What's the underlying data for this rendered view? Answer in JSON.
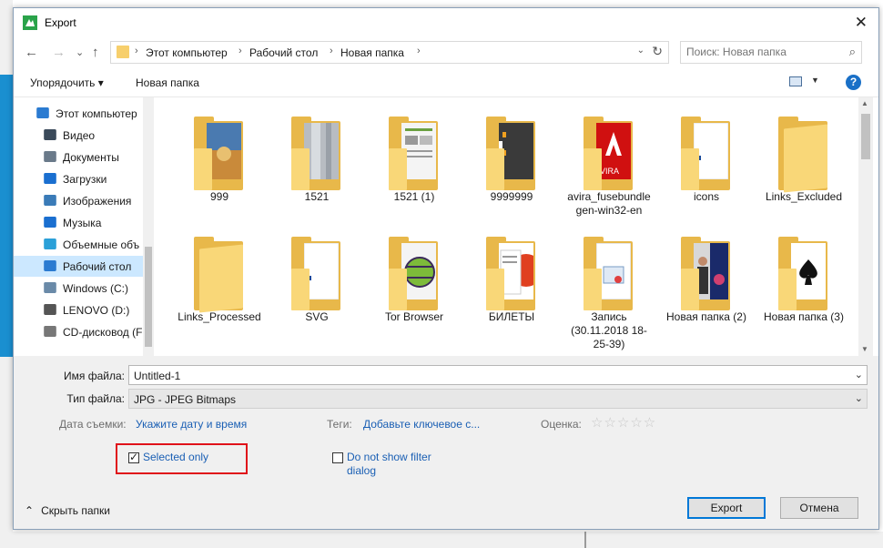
{
  "window": {
    "title": "Export",
    "close_glyph": "✕"
  },
  "nav": {
    "back_icon": "←",
    "forward_icon": "→",
    "recent_icon": "⌄",
    "up_icon": "↑",
    "breadcrumb": [
      "Этот компьютер",
      "Рабочий стол",
      "Новая папка"
    ],
    "separator": "›",
    "dropdown_icon": "⌄",
    "refresh_icon": "↻"
  },
  "search": {
    "placeholder": "Поиск: Новая папка",
    "icon": "⌕"
  },
  "toolbar": {
    "organize": "Упорядочить ▾",
    "new_folder": "Новая папка",
    "view_dd": "▼",
    "help": "?"
  },
  "sidebar": {
    "items": [
      {
        "label": "Этот компьютер",
        "icon": "computer-icon",
        "color": "#2b7bd1"
      },
      {
        "label": "Видео",
        "icon": "video-icon",
        "color": "#3a4a5a"
      },
      {
        "label": "Документы",
        "icon": "documents-icon",
        "color": "#6a7a8a"
      },
      {
        "label": "Загрузки",
        "icon": "downloads-icon",
        "color": "#1a6fd0"
      },
      {
        "label": "Изображения",
        "icon": "pictures-icon",
        "color": "#3a7bb8"
      },
      {
        "label": "Музыка",
        "icon": "music-icon",
        "color": "#1a6fd0"
      },
      {
        "label": "Объемные объ",
        "icon": "3d-objects-icon",
        "color": "#2ba0d8"
      },
      {
        "label": "Рабочий стол",
        "icon": "desktop-icon",
        "color": "#2b7bd1",
        "selected": true
      },
      {
        "label": "Windows (C:)",
        "icon": "drive-windows-icon",
        "color": "#6a8aa8"
      },
      {
        "label": "LENOVO (D:)",
        "icon": "drive-icon",
        "color": "#555555"
      },
      {
        "label": "CD-дисковод (F",
        "icon": "cd-drive-icon",
        "color": "#777777"
      }
    ]
  },
  "files": [
    {
      "name": "999",
      "preview": "photo"
    },
    {
      "name": "1521",
      "preview": "metal"
    },
    {
      "name": "1521 (1)",
      "preview": "document"
    },
    {
      "name": "9999999",
      "preview": "dark"
    },
    {
      "name": "avira_fusebundle gen-win32-en",
      "preview": "avira"
    },
    {
      "name": "icons",
      "preview": "paper"
    },
    {
      "name": "Links_Excluded",
      "preview": "empty"
    },
    {
      "name": "Links_Processed",
      "preview": "empty"
    },
    {
      "name": "SVG",
      "preview": "paper"
    },
    {
      "name": "Tor Browser",
      "preview": "tor"
    },
    {
      "name": "БИЛЕТЫ",
      "preview": "tickets"
    },
    {
      "name": "Запись (30.11.2018 18-25-39)",
      "preview": "file"
    },
    {
      "name": "Новая папка (2)",
      "preview": "people"
    },
    {
      "name": "Новая папка (3)",
      "preview": "spades"
    }
  ],
  "form": {
    "filename_label": "Имя файла:",
    "filename_value": "Untitled-1",
    "filetype_label": "Тип файла:",
    "filetype_value": "JPG - JPEG Bitmaps",
    "dd_icon": "⌄",
    "date_label": "Дата съемки:",
    "date_link": "Укажите дату и время",
    "tags_label": "Теги:",
    "tags_link": "Добавьте ключевое с...",
    "rating_label": "Оценка:",
    "rating_stars": "☆☆☆☆☆",
    "selected_only": "Selected only",
    "selected_only_checked": true,
    "no_filter": "Do not show filter dialog",
    "no_filter_checked": false
  },
  "footer": {
    "hide_folders": "Скрыть папки",
    "hide_icon": "⌃",
    "export": "Export",
    "cancel": "Отмена"
  },
  "colors": {
    "accent": "#0078d7",
    "link": "#1a5fb4",
    "highlight_box": "#e0121a",
    "folder": "#f9d778"
  }
}
